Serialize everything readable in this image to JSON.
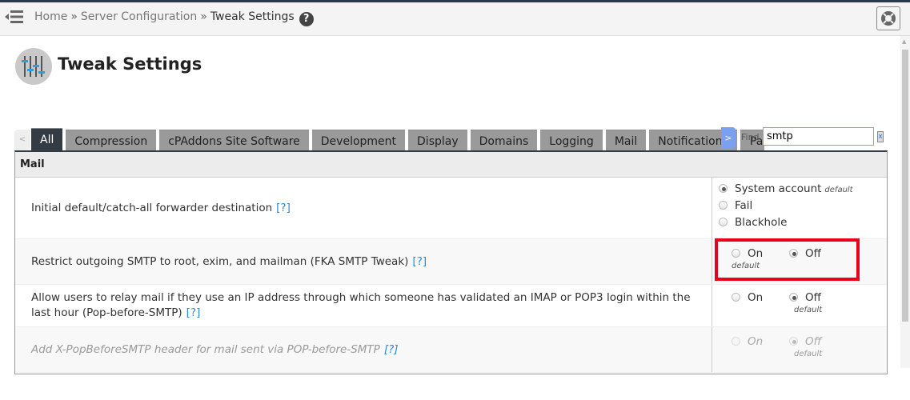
{
  "header": {
    "breadcrumb": [
      {
        "label": "Home"
      },
      {
        "label": "Server Configuration"
      },
      {
        "label": "Tweak Settings"
      }
    ],
    "separator": "»",
    "help_glyph": "?",
    "menu_icon": "menu-collapse-icon",
    "support_icon": "life-ring-icon"
  },
  "page": {
    "title": "Tweak Settings",
    "icon": "sliders-icon"
  },
  "tabs": {
    "scroll_left": "<",
    "scroll_right": ">",
    "items": [
      {
        "label": "All",
        "active": true
      },
      {
        "label": "Compression"
      },
      {
        "label": "cPAddons Site Software"
      },
      {
        "label": "Development"
      },
      {
        "label": "Display"
      },
      {
        "label": "Domains"
      },
      {
        "label": "Logging"
      },
      {
        "label": "Mail"
      },
      {
        "label": "Notifications"
      },
      {
        "label": "Pa"
      }
    ]
  },
  "find": {
    "label": "Find",
    "value": "smtp",
    "clear_glyph": "x"
  },
  "panel": {
    "heading": "Mail",
    "rows": [
      {
        "label": "Initial default/catch-all forwarder destination",
        "help": "[?]",
        "options": [
          {
            "label": "System account",
            "checked": true,
            "default": "default"
          },
          {
            "label": "Fail",
            "checked": false
          },
          {
            "label": "Blackhole",
            "checked": false
          }
        ]
      },
      {
        "label": "Restrict outgoing SMTP to root, exim, and mailman (FKA SMTP Tweak)",
        "help": "[?]",
        "highlighted": true,
        "options": [
          {
            "label": "On",
            "checked": false,
            "default": "default"
          },
          {
            "label": "Off",
            "checked": true
          }
        ]
      },
      {
        "label": "Allow users to relay mail if they use an IP address through which someone has validated an IMAP or POP3 login within the last hour (Pop-before-SMTP)",
        "help": "[?]",
        "options": [
          {
            "label": "On",
            "checked": false
          },
          {
            "label": "Off",
            "checked": true,
            "default": "default"
          }
        ]
      },
      {
        "label": "Add X-PopBeforeSMTP header for mail sent via POP-before-SMTP",
        "help": "[?]",
        "disabled": true,
        "options": [
          {
            "label": "On",
            "checked": false
          },
          {
            "label": "Off",
            "checked": true,
            "default": "default"
          }
        ]
      }
    ]
  },
  "colors": {
    "highlight": "#e8001b",
    "active_tab": "#333b45",
    "link": "#2a8ad6",
    "scroll_right": "#7aa0f2"
  }
}
